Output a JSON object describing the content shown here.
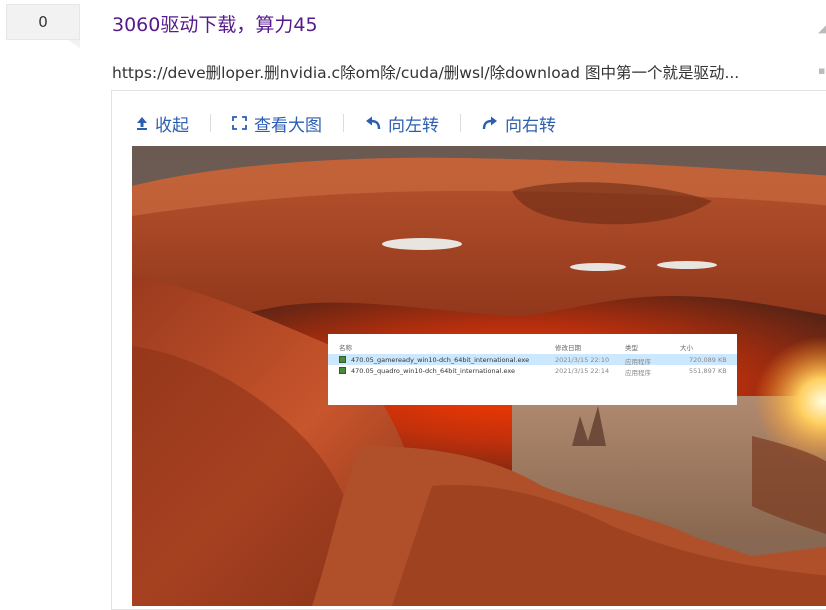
{
  "result": {
    "vote_count": "0",
    "title": "3060驱动下载，算力45",
    "snippet": "https://deve删loper.删nvidia.c除om除/cuda/删wsl/除download 图中第一个就是驱动..."
  },
  "toolbar": {
    "collapse_label": "收起",
    "view_large_label": "查看大图",
    "rotate_left_label": "向左转",
    "rotate_right_label": "向右转"
  },
  "explorer": {
    "columns": [
      "名称",
      "修改日期",
      "类型",
      "大小"
    ],
    "rows": [
      {
        "name": "470.05_gameready_win10-dch_64bit_international.exe",
        "date": "2021/3/15 22:10",
        "type": "应用程序",
        "size": "720,089 KB"
      },
      {
        "name": "470.05_quadro_win10-dch_64bit_international.exe",
        "date": "2021/3/15 22:14",
        "type": "应用程序",
        "size": "551,897 KB"
      }
    ]
  },
  "icons": [
    "collapse-arrow-icon",
    "expand-corners-icon",
    "rotate-left-icon",
    "rotate-right-icon"
  ],
  "colors": {
    "title": "#551a8b",
    "toolbar_link": "#2c5eb3",
    "selection": "#cce8ff"
  }
}
